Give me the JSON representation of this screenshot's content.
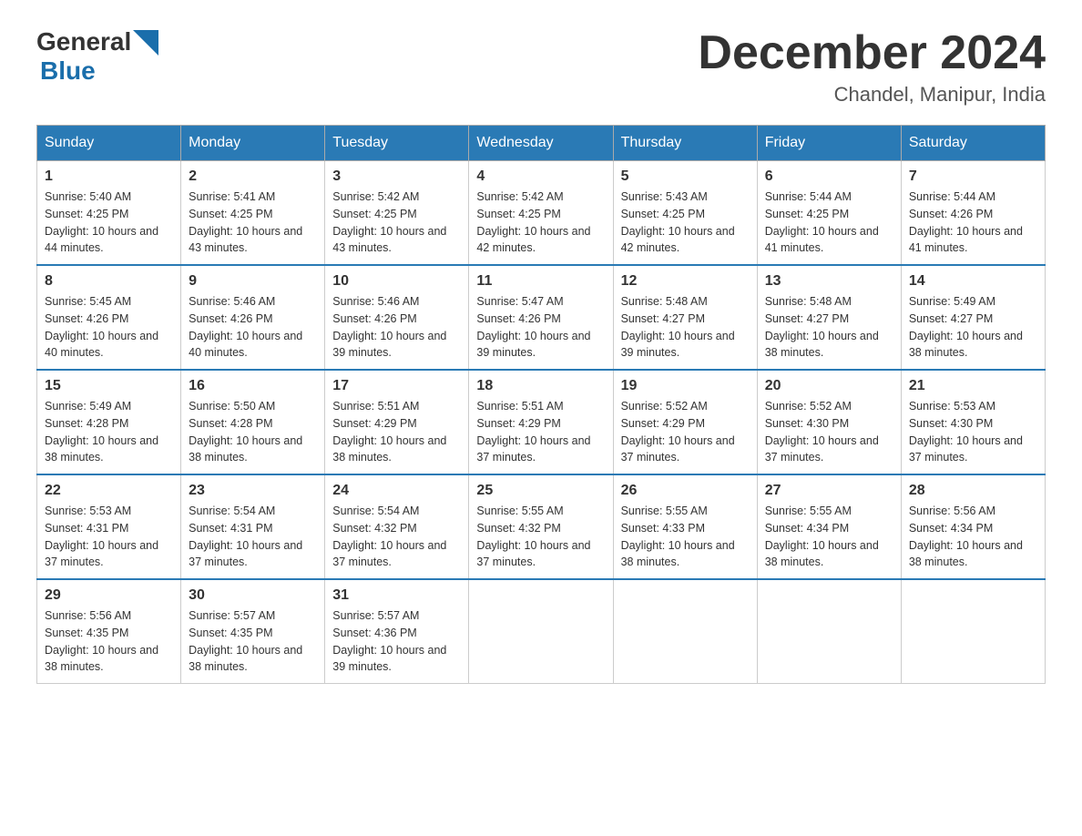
{
  "header": {
    "logo_general": "General",
    "logo_blue": "Blue",
    "month_title": "December 2024",
    "subtitle": "Chandel, Manipur, India"
  },
  "weekdays": [
    "Sunday",
    "Monday",
    "Tuesday",
    "Wednesday",
    "Thursday",
    "Friday",
    "Saturday"
  ],
  "weeks": [
    [
      {
        "day": "1",
        "sunrise": "5:40 AM",
        "sunset": "4:25 PM",
        "daylight": "10 hours and 44 minutes."
      },
      {
        "day": "2",
        "sunrise": "5:41 AM",
        "sunset": "4:25 PM",
        "daylight": "10 hours and 43 minutes."
      },
      {
        "day": "3",
        "sunrise": "5:42 AM",
        "sunset": "4:25 PM",
        "daylight": "10 hours and 43 minutes."
      },
      {
        "day": "4",
        "sunrise": "5:42 AM",
        "sunset": "4:25 PM",
        "daylight": "10 hours and 42 minutes."
      },
      {
        "day": "5",
        "sunrise": "5:43 AM",
        "sunset": "4:25 PM",
        "daylight": "10 hours and 42 minutes."
      },
      {
        "day": "6",
        "sunrise": "5:44 AM",
        "sunset": "4:25 PM",
        "daylight": "10 hours and 41 minutes."
      },
      {
        "day": "7",
        "sunrise": "5:44 AM",
        "sunset": "4:26 PM",
        "daylight": "10 hours and 41 minutes."
      }
    ],
    [
      {
        "day": "8",
        "sunrise": "5:45 AM",
        "sunset": "4:26 PM",
        "daylight": "10 hours and 40 minutes."
      },
      {
        "day": "9",
        "sunrise": "5:46 AM",
        "sunset": "4:26 PM",
        "daylight": "10 hours and 40 minutes."
      },
      {
        "day": "10",
        "sunrise": "5:46 AM",
        "sunset": "4:26 PM",
        "daylight": "10 hours and 39 minutes."
      },
      {
        "day": "11",
        "sunrise": "5:47 AM",
        "sunset": "4:26 PM",
        "daylight": "10 hours and 39 minutes."
      },
      {
        "day": "12",
        "sunrise": "5:48 AM",
        "sunset": "4:27 PM",
        "daylight": "10 hours and 39 minutes."
      },
      {
        "day": "13",
        "sunrise": "5:48 AM",
        "sunset": "4:27 PM",
        "daylight": "10 hours and 38 minutes."
      },
      {
        "day": "14",
        "sunrise": "5:49 AM",
        "sunset": "4:27 PM",
        "daylight": "10 hours and 38 minutes."
      }
    ],
    [
      {
        "day": "15",
        "sunrise": "5:49 AM",
        "sunset": "4:28 PM",
        "daylight": "10 hours and 38 minutes."
      },
      {
        "day": "16",
        "sunrise": "5:50 AM",
        "sunset": "4:28 PM",
        "daylight": "10 hours and 38 minutes."
      },
      {
        "day": "17",
        "sunrise": "5:51 AM",
        "sunset": "4:29 PM",
        "daylight": "10 hours and 38 minutes."
      },
      {
        "day": "18",
        "sunrise": "5:51 AM",
        "sunset": "4:29 PM",
        "daylight": "10 hours and 37 minutes."
      },
      {
        "day": "19",
        "sunrise": "5:52 AM",
        "sunset": "4:29 PM",
        "daylight": "10 hours and 37 minutes."
      },
      {
        "day": "20",
        "sunrise": "5:52 AM",
        "sunset": "4:30 PM",
        "daylight": "10 hours and 37 minutes."
      },
      {
        "day": "21",
        "sunrise": "5:53 AM",
        "sunset": "4:30 PM",
        "daylight": "10 hours and 37 minutes."
      }
    ],
    [
      {
        "day": "22",
        "sunrise": "5:53 AM",
        "sunset": "4:31 PM",
        "daylight": "10 hours and 37 minutes."
      },
      {
        "day": "23",
        "sunrise": "5:54 AM",
        "sunset": "4:31 PM",
        "daylight": "10 hours and 37 minutes."
      },
      {
        "day": "24",
        "sunrise": "5:54 AM",
        "sunset": "4:32 PM",
        "daylight": "10 hours and 37 minutes."
      },
      {
        "day": "25",
        "sunrise": "5:55 AM",
        "sunset": "4:32 PM",
        "daylight": "10 hours and 37 minutes."
      },
      {
        "day": "26",
        "sunrise": "5:55 AM",
        "sunset": "4:33 PM",
        "daylight": "10 hours and 38 minutes."
      },
      {
        "day": "27",
        "sunrise": "5:55 AM",
        "sunset": "4:34 PM",
        "daylight": "10 hours and 38 minutes."
      },
      {
        "day": "28",
        "sunrise": "5:56 AM",
        "sunset": "4:34 PM",
        "daylight": "10 hours and 38 minutes."
      }
    ],
    [
      {
        "day": "29",
        "sunrise": "5:56 AM",
        "sunset": "4:35 PM",
        "daylight": "10 hours and 38 minutes."
      },
      {
        "day": "30",
        "sunrise": "5:57 AM",
        "sunset": "4:35 PM",
        "daylight": "10 hours and 38 minutes."
      },
      {
        "day": "31",
        "sunrise": "5:57 AM",
        "sunset": "4:36 PM",
        "daylight": "10 hours and 39 minutes."
      },
      null,
      null,
      null,
      null
    ]
  ]
}
